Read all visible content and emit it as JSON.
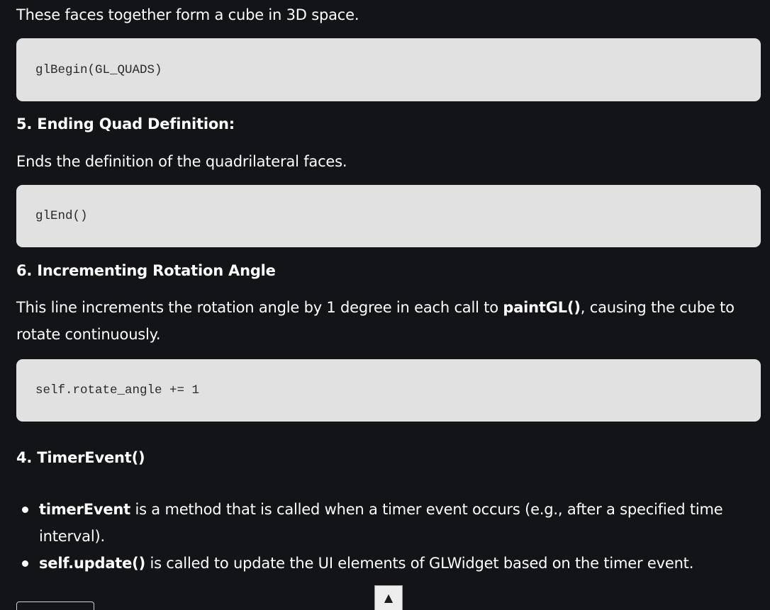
{
  "article": {
    "intro_text": "These faces together form a cube in 3D space.",
    "code_1": "glBegin(GL_QUADS)",
    "heading_5": "5. Ending Quad Definition:",
    "para_5": "Ends the definition of the quadrilateral faces.",
    "code_2": "glEnd()",
    "heading_6": "6. Incrementing Rotation Angle",
    "para_6_before": "This line increments the rotation angle by 1 degree in each call to ",
    "para_6_bold": "paintGL()",
    "para_6_after": ", causing the cube to rotate continuously.",
    "code_3": "self.rotate_angle += 1",
    "section_heading": "4. TimerEvent()",
    "bullets": [
      {
        "bold": "timerEvent",
        "text": " is a method that is called when a timer event occurs (e.g., after a specified time interval)."
      },
      {
        "bold": "self.update()",
        "text": " is called to update the UI elements of GLWidget based on the timer event."
      }
    ]
  },
  "scroll_top": {
    "label": "▲"
  },
  "colors": {
    "page_background": "#131417",
    "text": "#ffffff",
    "code_background": "#e1e1e1",
    "code_text": "#2a2a2a"
  }
}
